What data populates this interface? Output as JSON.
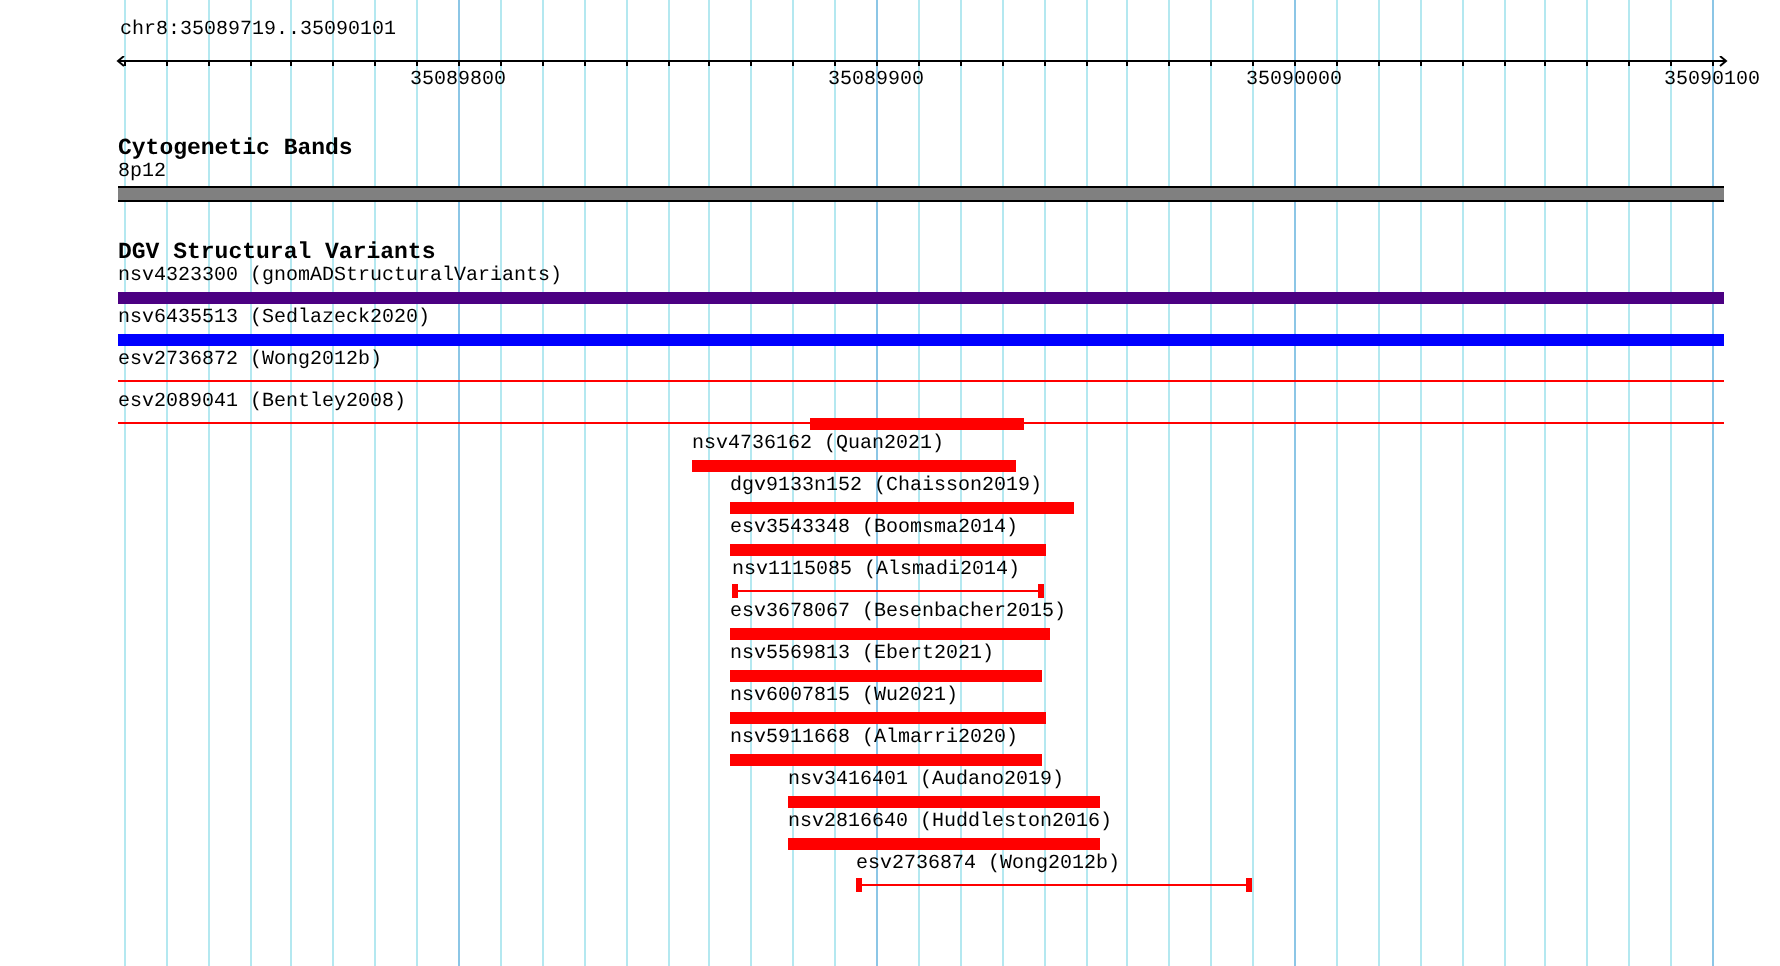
{
  "ruler": {
    "location": "chr8:35089719..35090101",
    "ticks": [
      "35089800",
      "35089900",
      "35090000",
      "35090100"
    ]
  },
  "tracks": [
    {
      "title": "Cytogenetic Bands",
      "kind": "bands",
      "features": [
        {
          "label": "8p12",
          "kind": "band"
        }
      ]
    },
    {
      "title": "DGV Structural Variants",
      "kind": "variants",
      "features": [
        {
          "label": "nsv4323300 (gnomADStructuralVariants)",
          "kind": "bar",
          "color": "#4b0082"
        },
        {
          "label": "nsv6435513 (Sedlazeck2020)",
          "kind": "bar",
          "color": "#0000ff"
        },
        {
          "label": "esv2736872 (Wong2012b)",
          "kind": "line",
          "color": "#ff0000"
        },
        {
          "label": "esv2089041 (Bentley2008)",
          "kind": "line",
          "color": "#ff0000"
        },
        {
          "kind": "bar",
          "color": "#ff0000"
        },
        {
          "label": "nsv4736162 (Quan2021)",
          "kind": "bar",
          "color": "#ff0000"
        },
        {
          "label": "dgv9133n152 (Chaisson2019)",
          "kind": "bar",
          "color": "#ff0000"
        },
        {
          "label": "esv3543348 (Boomsma2014)",
          "kind": "bar",
          "color": "#ff0000"
        },
        {
          "label": "nsv1115085 (Alsmadi2014)",
          "kind": "span",
          "color": "#ff0000"
        },
        {
          "label": "esv3678067 (Besenbacher2015)",
          "kind": "bar",
          "color": "#ff0000"
        },
        {
          "label": "nsv5569813 (Ebert2021)",
          "kind": "bar",
          "color": "#ff0000"
        },
        {
          "label": "nsv6007815 (Wu2021)",
          "kind": "bar",
          "color": "#ff0000"
        },
        {
          "label": "nsv5911668 (Almarri2020)",
          "kind": "bar",
          "color": "#ff0000"
        },
        {
          "label": "nsv3416401 (Audano2019)",
          "kind": "bar",
          "color": "#ff0000"
        },
        {
          "label": "nsv2816640 (Huddleston2016)",
          "kind": "bar",
          "color": "#ff0000"
        },
        {
          "label": "esv2736874 (Wong2012b)",
          "kind": "span",
          "color": "#ff0000"
        }
      ]
    }
  ]
}
